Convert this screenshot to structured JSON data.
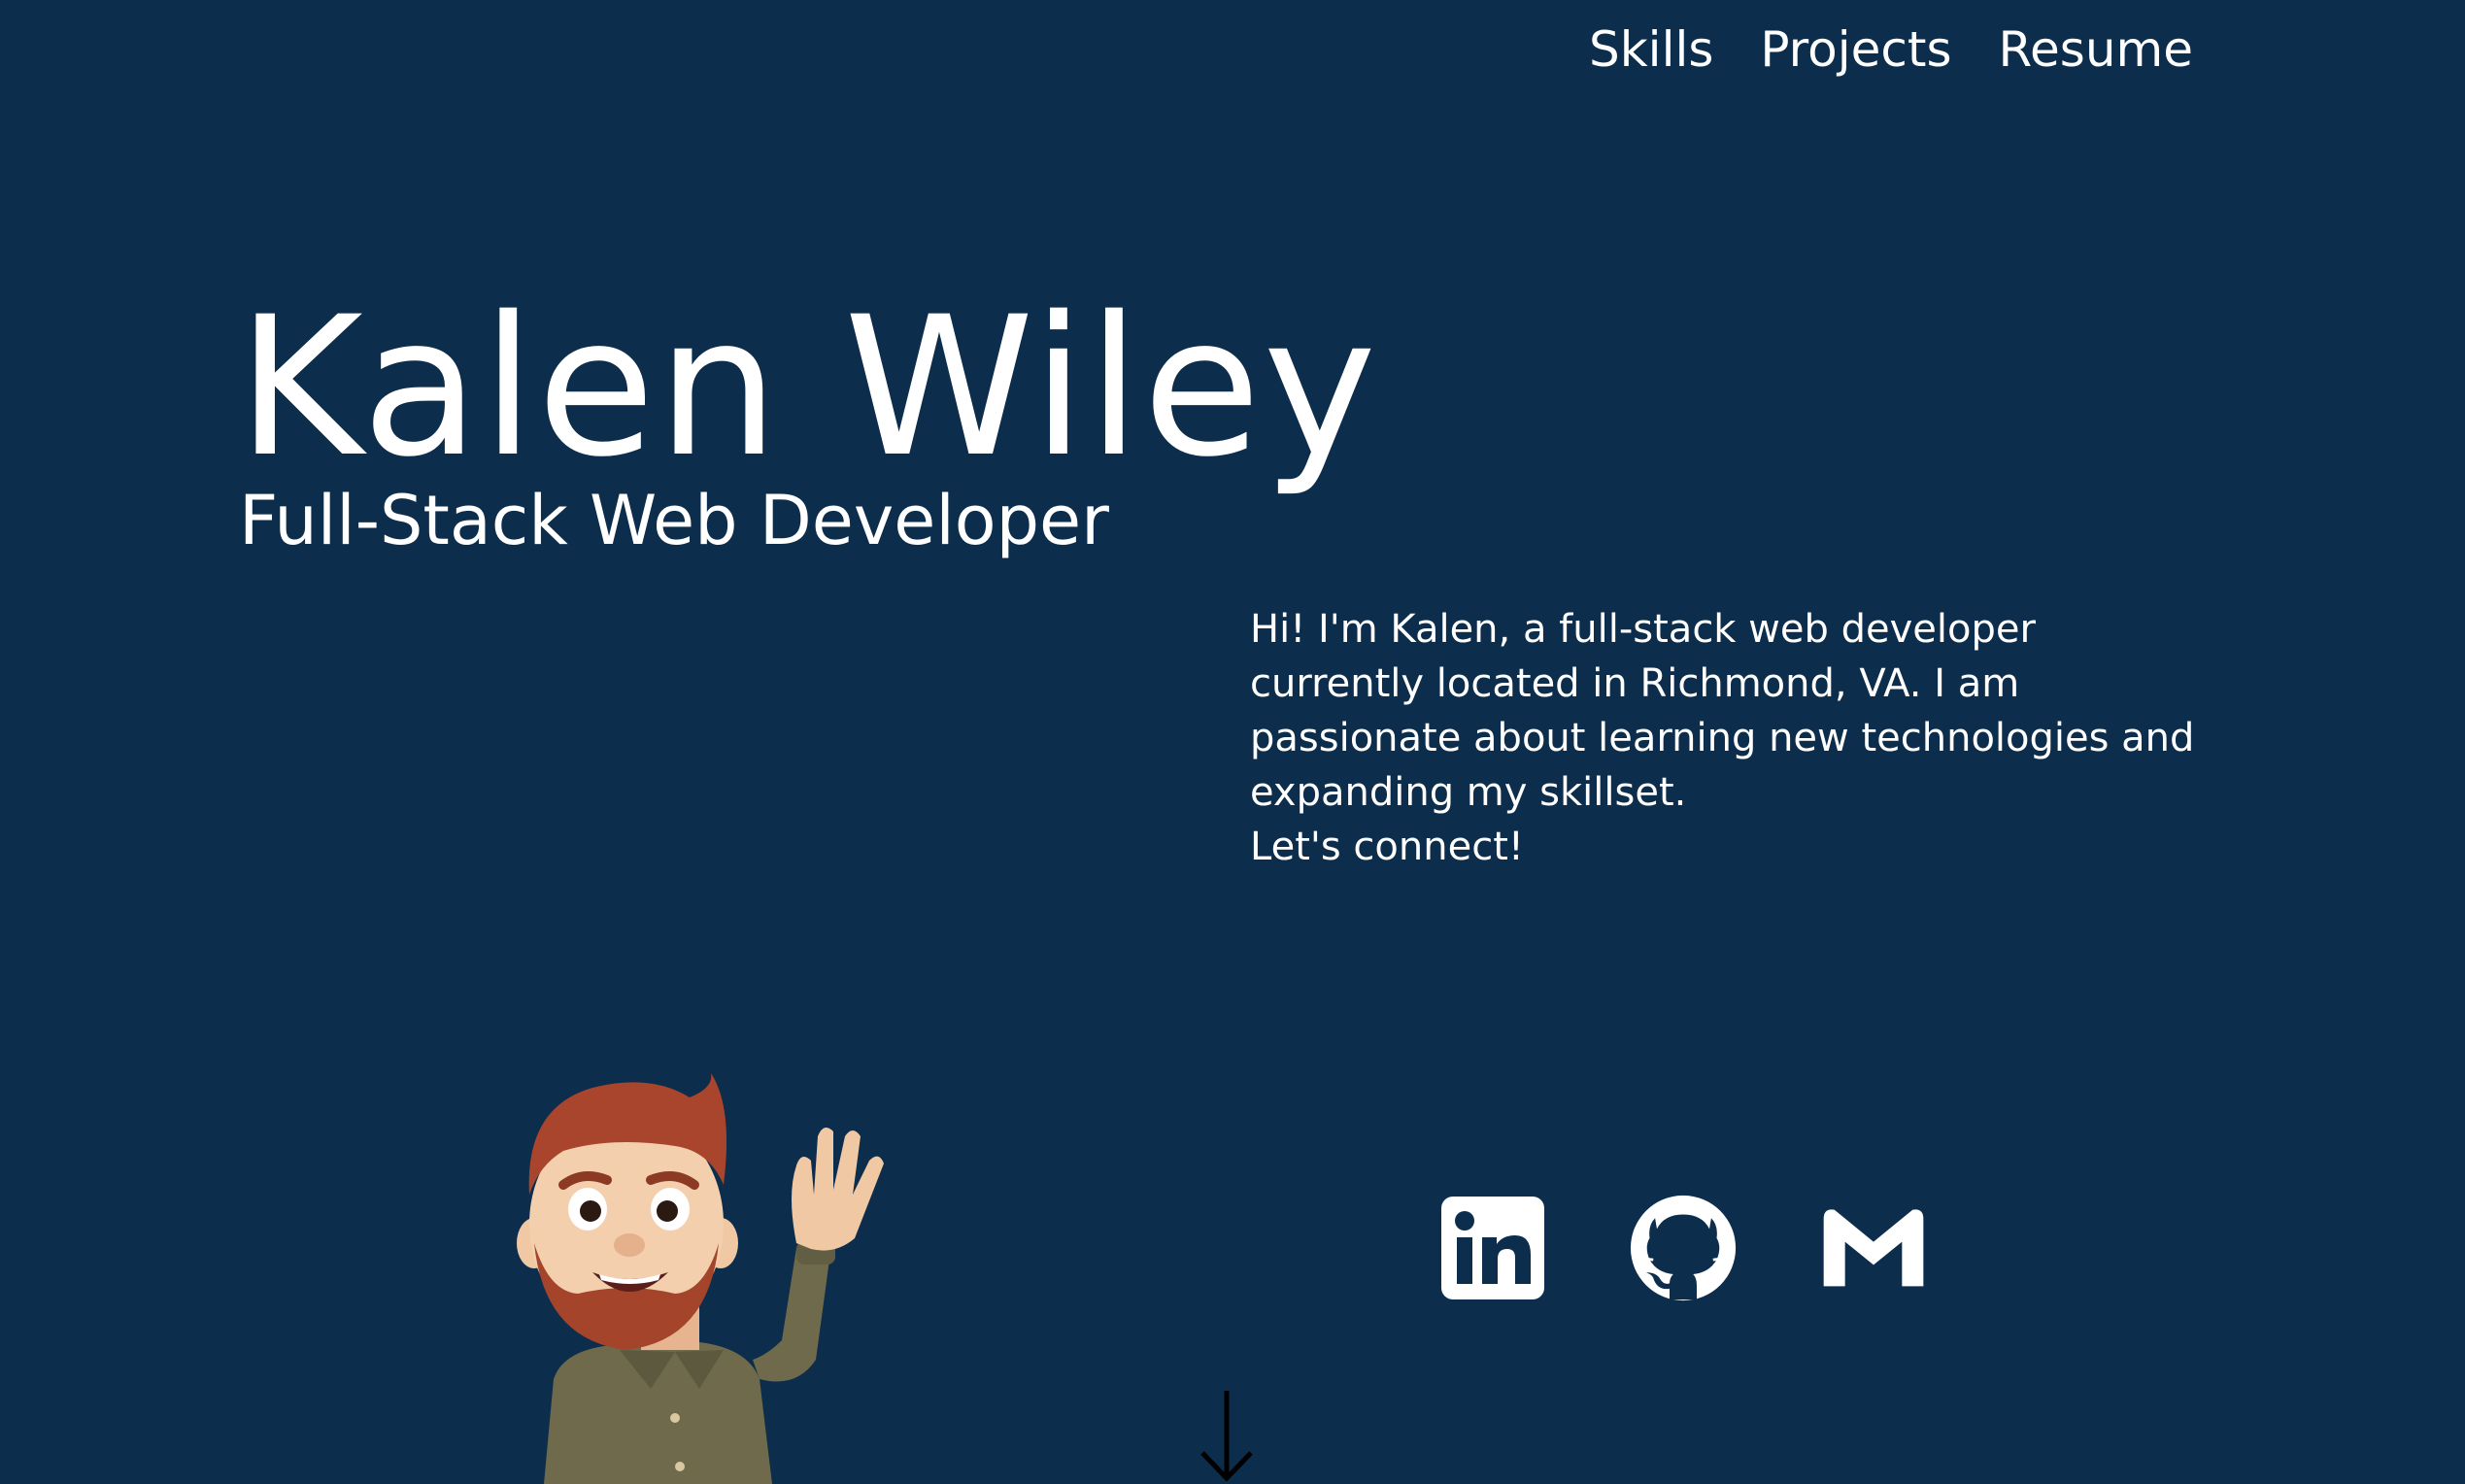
{
  "nav": {
    "items": [
      {
        "label": "Skills"
      },
      {
        "label": "Projects"
      },
      {
        "label": "Resume"
      }
    ]
  },
  "hero": {
    "name": "Kalen Wiley",
    "subtitle": "Full-Stack Web Developer"
  },
  "bio": {
    "paragraph": "Hi! I'm Kalen, a full-stack web developer currently located in Richmond, VA. I am passionate about learning new technologies and expanding my skillset.",
    "cta": "Let's connect!"
  },
  "socials": [
    {
      "icon": "linkedin-icon"
    },
    {
      "icon": "github-icon"
    },
    {
      "icon": "gmail-icon"
    }
  ],
  "avatar": {
    "icon": "memoji-waving-avatar"
  },
  "scroll": {
    "icon": "arrow-down-icon"
  },
  "colors": {
    "background": "#0c2d4b",
    "text": "#ffffff",
    "arrow": "#000000"
  }
}
